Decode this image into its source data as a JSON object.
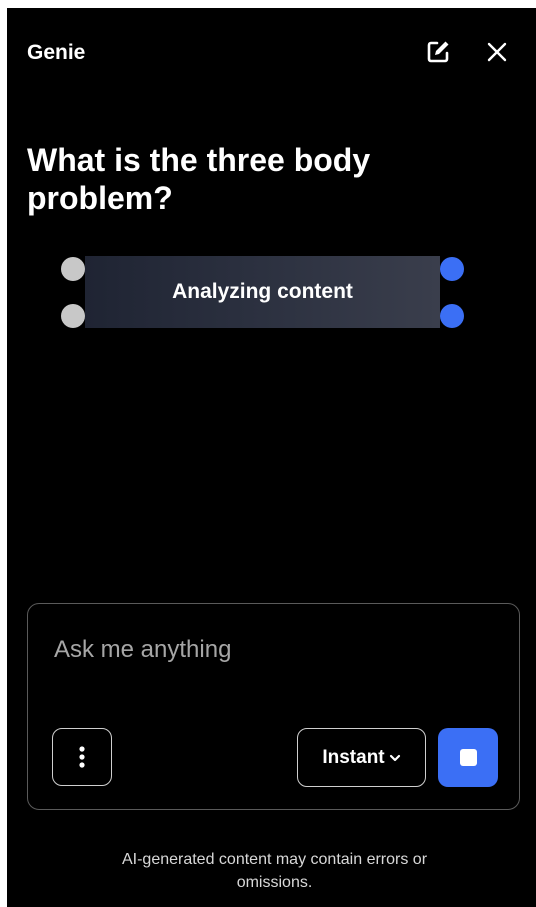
{
  "header": {
    "title": "Genie",
    "edit_icon": "edit-icon",
    "close_icon": "close-icon"
  },
  "question": "What is the three body problem?",
  "status_node": {
    "label": "Analyzing content",
    "colors": {
      "left_handles": "#c8c8c8",
      "right_handles": "#3b6ff5"
    }
  },
  "input": {
    "placeholder": "Ask me anything",
    "menu_icon": "more-vertical-icon",
    "mode_label": "Instant",
    "mode_icon": "chevron-down-icon",
    "stop_icon": "stop-icon"
  },
  "footer": {
    "disclaimer": "AI-generated content may contain errors or omissions."
  },
  "colors": {
    "background": "#000000",
    "accent": "#3b6ff5",
    "text": "#ffffff",
    "placeholder": "#a6a6a6"
  }
}
